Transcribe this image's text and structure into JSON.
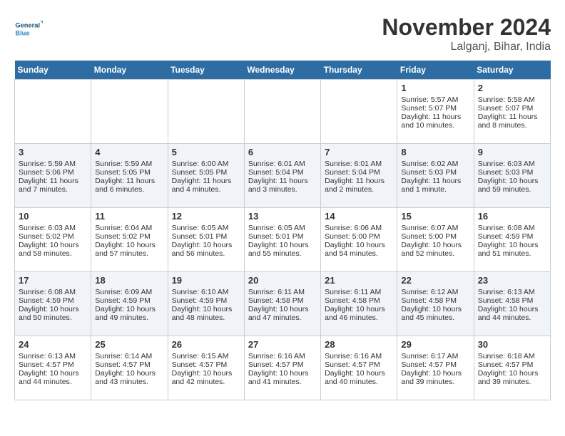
{
  "logo": {
    "line1": "General",
    "line2": "Blue"
  },
  "header": {
    "month": "November 2024",
    "location": "Lalganj, Bihar, India"
  },
  "weekdays": [
    "Sunday",
    "Monday",
    "Tuesday",
    "Wednesday",
    "Thursday",
    "Friday",
    "Saturday"
  ],
  "rows": [
    [
      {
        "day": "",
        "content": ""
      },
      {
        "day": "",
        "content": ""
      },
      {
        "day": "",
        "content": ""
      },
      {
        "day": "",
        "content": ""
      },
      {
        "day": "",
        "content": ""
      },
      {
        "day": "1",
        "content": "Sunrise: 5:57 AM\nSunset: 5:07 PM\nDaylight: 11 hours and 10 minutes."
      },
      {
        "day": "2",
        "content": "Sunrise: 5:58 AM\nSunset: 5:07 PM\nDaylight: 11 hours and 8 minutes."
      }
    ],
    [
      {
        "day": "3",
        "content": "Sunrise: 5:59 AM\nSunset: 5:06 PM\nDaylight: 11 hours and 7 minutes."
      },
      {
        "day": "4",
        "content": "Sunrise: 5:59 AM\nSunset: 5:05 PM\nDaylight: 11 hours and 6 minutes."
      },
      {
        "day": "5",
        "content": "Sunrise: 6:00 AM\nSunset: 5:05 PM\nDaylight: 11 hours and 4 minutes."
      },
      {
        "day": "6",
        "content": "Sunrise: 6:01 AM\nSunset: 5:04 PM\nDaylight: 11 hours and 3 minutes."
      },
      {
        "day": "7",
        "content": "Sunrise: 6:01 AM\nSunset: 5:04 PM\nDaylight: 11 hours and 2 minutes."
      },
      {
        "day": "8",
        "content": "Sunrise: 6:02 AM\nSunset: 5:03 PM\nDaylight: 11 hours and 1 minute."
      },
      {
        "day": "9",
        "content": "Sunrise: 6:03 AM\nSunset: 5:03 PM\nDaylight: 10 hours and 59 minutes."
      }
    ],
    [
      {
        "day": "10",
        "content": "Sunrise: 6:03 AM\nSunset: 5:02 PM\nDaylight: 10 hours and 58 minutes."
      },
      {
        "day": "11",
        "content": "Sunrise: 6:04 AM\nSunset: 5:02 PM\nDaylight: 10 hours and 57 minutes."
      },
      {
        "day": "12",
        "content": "Sunrise: 6:05 AM\nSunset: 5:01 PM\nDaylight: 10 hours and 56 minutes."
      },
      {
        "day": "13",
        "content": "Sunrise: 6:05 AM\nSunset: 5:01 PM\nDaylight: 10 hours and 55 minutes."
      },
      {
        "day": "14",
        "content": "Sunrise: 6:06 AM\nSunset: 5:00 PM\nDaylight: 10 hours and 54 minutes."
      },
      {
        "day": "15",
        "content": "Sunrise: 6:07 AM\nSunset: 5:00 PM\nDaylight: 10 hours and 52 minutes."
      },
      {
        "day": "16",
        "content": "Sunrise: 6:08 AM\nSunset: 4:59 PM\nDaylight: 10 hours and 51 minutes."
      }
    ],
    [
      {
        "day": "17",
        "content": "Sunrise: 6:08 AM\nSunset: 4:59 PM\nDaylight: 10 hours and 50 minutes."
      },
      {
        "day": "18",
        "content": "Sunrise: 6:09 AM\nSunset: 4:59 PM\nDaylight: 10 hours and 49 minutes."
      },
      {
        "day": "19",
        "content": "Sunrise: 6:10 AM\nSunset: 4:59 PM\nDaylight: 10 hours and 48 minutes."
      },
      {
        "day": "20",
        "content": "Sunrise: 6:11 AM\nSunset: 4:58 PM\nDaylight: 10 hours and 47 minutes."
      },
      {
        "day": "21",
        "content": "Sunrise: 6:11 AM\nSunset: 4:58 PM\nDaylight: 10 hours and 46 minutes."
      },
      {
        "day": "22",
        "content": "Sunrise: 6:12 AM\nSunset: 4:58 PM\nDaylight: 10 hours and 45 minutes."
      },
      {
        "day": "23",
        "content": "Sunrise: 6:13 AM\nSunset: 4:58 PM\nDaylight: 10 hours and 44 minutes."
      }
    ],
    [
      {
        "day": "24",
        "content": "Sunrise: 6:13 AM\nSunset: 4:57 PM\nDaylight: 10 hours and 44 minutes."
      },
      {
        "day": "25",
        "content": "Sunrise: 6:14 AM\nSunset: 4:57 PM\nDaylight: 10 hours and 43 minutes."
      },
      {
        "day": "26",
        "content": "Sunrise: 6:15 AM\nSunset: 4:57 PM\nDaylight: 10 hours and 42 minutes."
      },
      {
        "day": "27",
        "content": "Sunrise: 6:16 AM\nSunset: 4:57 PM\nDaylight: 10 hours and 41 minutes."
      },
      {
        "day": "28",
        "content": "Sunrise: 6:16 AM\nSunset: 4:57 PM\nDaylight: 10 hours and 40 minutes."
      },
      {
        "day": "29",
        "content": "Sunrise: 6:17 AM\nSunset: 4:57 PM\nDaylight: 10 hours and 39 minutes."
      },
      {
        "day": "30",
        "content": "Sunrise: 6:18 AM\nSunset: 4:57 PM\nDaylight: 10 hours and 39 minutes."
      }
    ]
  ]
}
